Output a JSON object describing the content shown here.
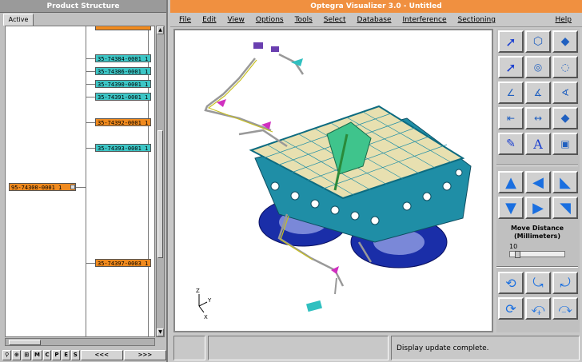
{
  "product_structure": {
    "title": "Product Structure",
    "tab_active": "Active",
    "root_node": "95-74300-0001_1",
    "children": [
      {
        "label": "35-74384-0001_1",
        "color": "cyan"
      },
      {
        "label": "35-74386-0001_1",
        "color": "cyan"
      },
      {
        "label": "35-74390-0001_1",
        "color": "cyan"
      },
      {
        "label": "35-74391-0001_1",
        "color": "cyan"
      },
      {
        "label": "35-74392-0001_1",
        "color": "orange"
      },
      {
        "label": "35-74393-0001_1",
        "color": "cyan"
      },
      {
        "label": "35-74397-0003_1",
        "color": "orange"
      }
    ],
    "bottom_buttons": [
      "M",
      "C",
      "P",
      "E",
      "S"
    ],
    "scroll_left": "<<<",
    "scroll_right": ">>>"
  },
  "main_window": {
    "title": "Optegra Visualizer 3.0 - Untitled",
    "menus": [
      "File",
      "Edit",
      "View",
      "Options",
      "Tools",
      "Select",
      "Database",
      "Interference",
      "Sectioning"
    ],
    "help": "Help",
    "axis_labels": {
      "z": "Z",
      "y": "Y",
      "x": "X"
    }
  },
  "move_distance": {
    "title_line1": "Move Distance",
    "title_line2": "(Millimeters)",
    "value": "10"
  },
  "status": {
    "message": "Display update complete."
  },
  "colors": {
    "title_orange": "#f09040",
    "node_cyan": "#3cc6c6",
    "node_orange": "#f08a1e",
    "model_blue": "#1a2ea8",
    "model_teal": "#1a7f9a"
  }
}
